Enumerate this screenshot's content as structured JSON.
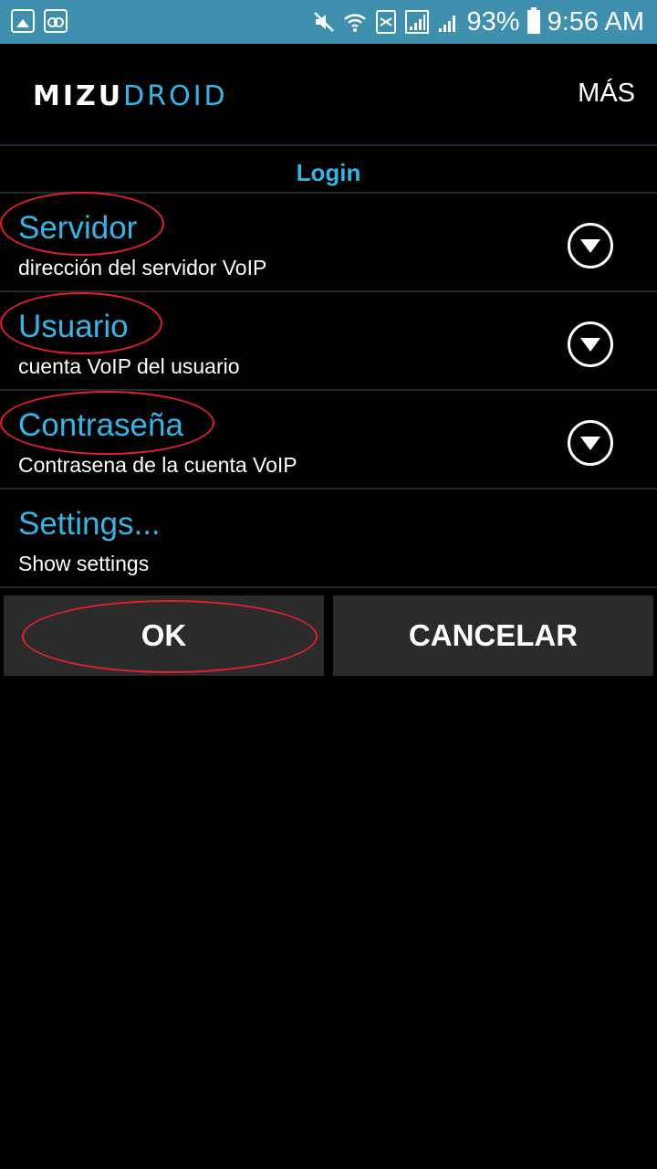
{
  "status_bar": {
    "battery": "93%",
    "time": "9:56 AM",
    "icons": [
      "gallery-icon",
      "voicemail-icon",
      "mute-icon",
      "wifi-icon",
      "sim-icon",
      "signal-icon",
      "signal2-icon",
      "battery-icon"
    ]
  },
  "app_bar": {
    "logo_part1": "MIZU",
    "logo_part2": "DROID",
    "menu_label": "MÁS"
  },
  "section": {
    "title": "Login"
  },
  "preferences": [
    {
      "title": "Servidor",
      "summary": "dirección del servidor VoIP"
    },
    {
      "title": "Usuario",
      "summary": "cuenta VoIP del usuario"
    },
    {
      "title": "Contraseña",
      "summary": "Contrasena de la cuenta VoIP"
    },
    {
      "title": "Settings...",
      "summary": "Show settings"
    }
  ],
  "buttons": {
    "ok": "OK",
    "cancel": "CANCELAR"
  },
  "colors": {
    "status_bar": "#3f8fae",
    "accent": "#33b5e5",
    "annotation_red": "#e0202a",
    "button_bg": "#2b2b2b"
  }
}
